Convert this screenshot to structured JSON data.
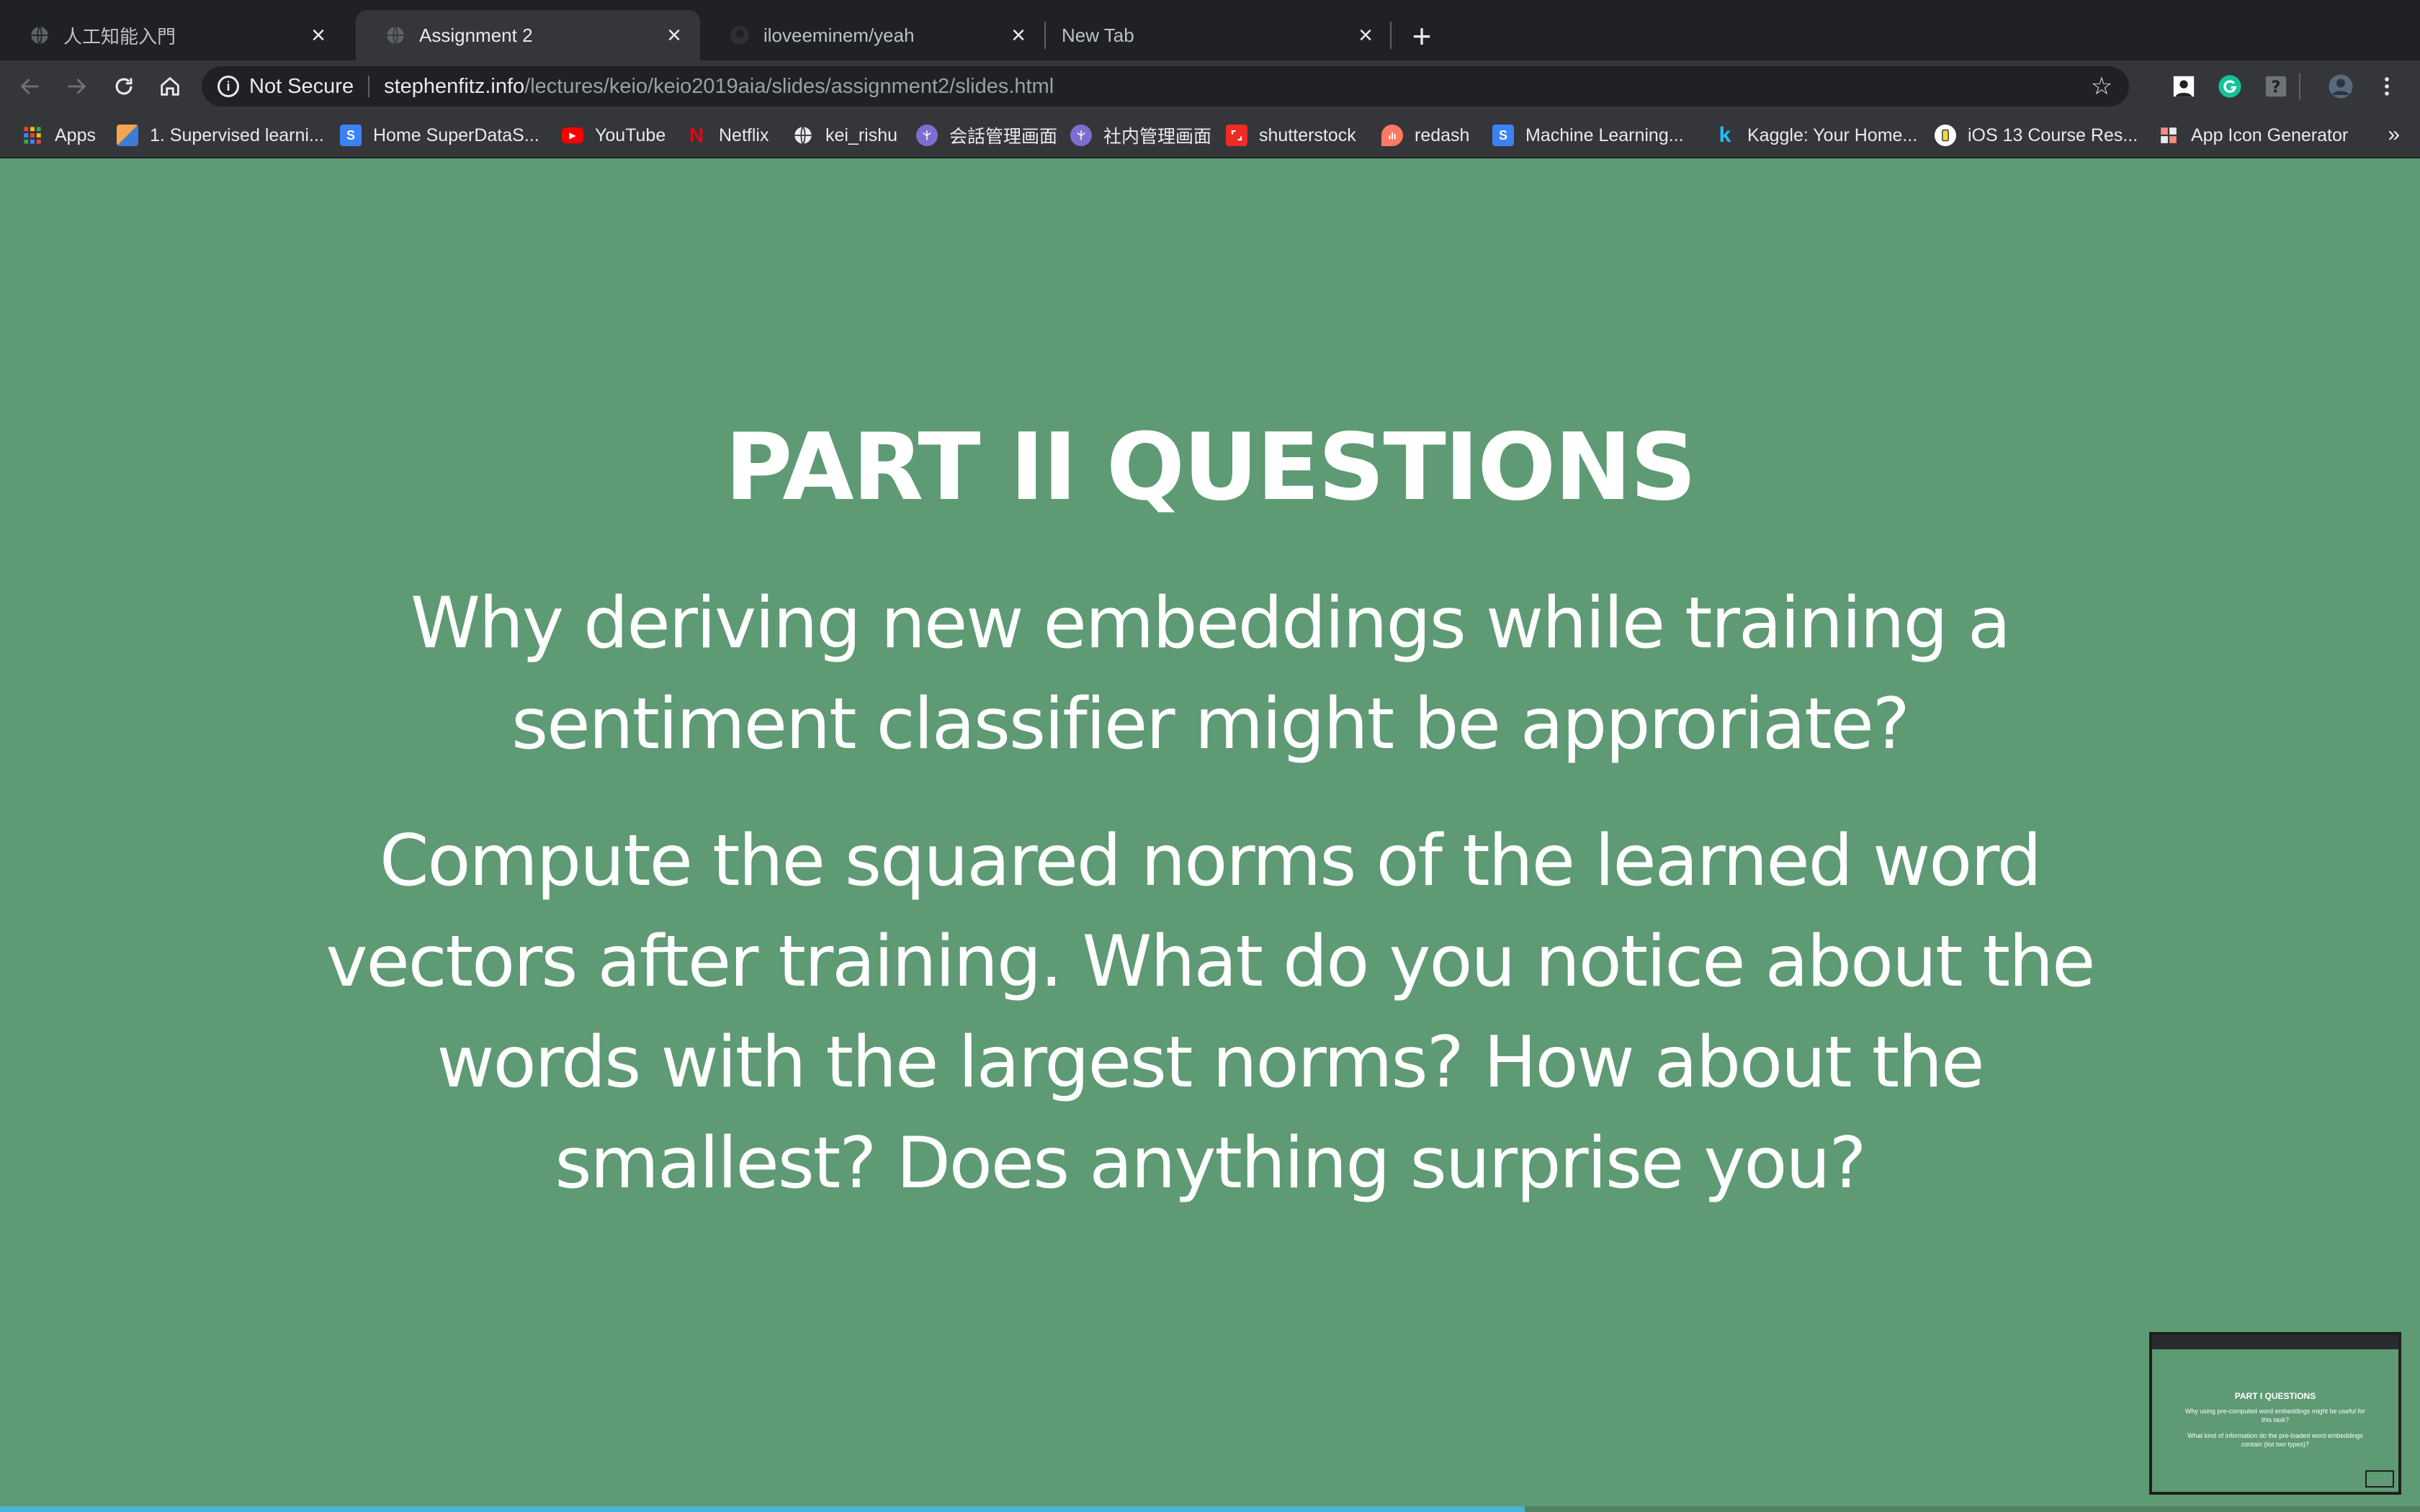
{
  "browser": {
    "tabs": [
      {
        "title": "人工知能入門",
        "active": false,
        "icon": "globe-icon"
      },
      {
        "title": "Assignment 2",
        "active": true,
        "icon": "globe-icon"
      },
      {
        "title": "iloveeminem/yeah",
        "active": false,
        "icon": "github-icon"
      },
      {
        "title": "New Tab",
        "active": false,
        "icon": "none"
      }
    ],
    "omnibox": {
      "security_label": "Not Secure",
      "host": "stephenfitz.info",
      "path": "/lectures/keio/keio2019aia/slides/assignment2/slides.html"
    },
    "bookmarks": [
      {
        "label": "Apps",
        "icon": "apps-grid-icon",
        "color": "#ea4335"
      },
      {
        "label": "1. Supervised learni...",
        "icon": "supervised-icon",
        "color": "#f6a54c"
      },
      {
        "label": "Home SuperDataS...",
        "icon": "superdatascience-icon",
        "color": "#3b82f6",
        "glyph": "S"
      },
      {
        "label": "YouTube",
        "icon": "youtube-icon",
        "color": "#ff0000",
        "glyph": "▶"
      },
      {
        "label": "Netflix",
        "icon": "netflix-icon",
        "color": "#e50914",
        "glyph": "N"
      },
      {
        "label": "kei_rishu",
        "icon": "globe-icon",
        "color": "#e8eaed"
      },
      {
        "label": "会話管理画面",
        "icon": "chat-admin-icon",
        "color": "#7c6fcf"
      },
      {
        "label": "社内管理画面",
        "icon": "internal-admin-icon",
        "color": "#7c6fcf"
      },
      {
        "label": "shutterstock",
        "icon": "shutterstock-icon",
        "color": "#ee2b24"
      },
      {
        "label": "redash",
        "icon": "redash-icon",
        "color": "#ff7964"
      },
      {
        "label": "Machine Learning...",
        "icon": "machine-learning-icon",
        "color": "#3b82f6",
        "glyph": "S"
      },
      {
        "label": "Kaggle: Your Home...",
        "icon": "kaggle-icon",
        "color": "#20beff",
        "glyph": "k"
      },
      {
        "label": "iOS 13 Course Res...",
        "icon": "ios-course-icon",
        "color": "#f5d547"
      },
      {
        "label": "App Icon Generator",
        "icon": "app-icon-generator-icon",
        "color": "#f28b82"
      }
    ],
    "bookmarks_overflow": "»"
  },
  "slide": {
    "title": "PART II QUESTIONS",
    "question_1": "Why deriving new embeddings while training a sentiment classifier might be approriate?",
    "question_2": "Compute the squared norms of the learned word vectors after training. What do you notice about the words with the largest norms? How about the smallest? Does anything surprise you?",
    "background_color": "#5e9a74",
    "progress": 0.63
  },
  "thumbnail": {
    "title": "PART I QUESTIONS",
    "question_1": "Why using pre-computed word embeddings might be useful for this task?",
    "question_2": "What kind of information do the pre-loaded word embeddings contain (list two types)?"
  }
}
